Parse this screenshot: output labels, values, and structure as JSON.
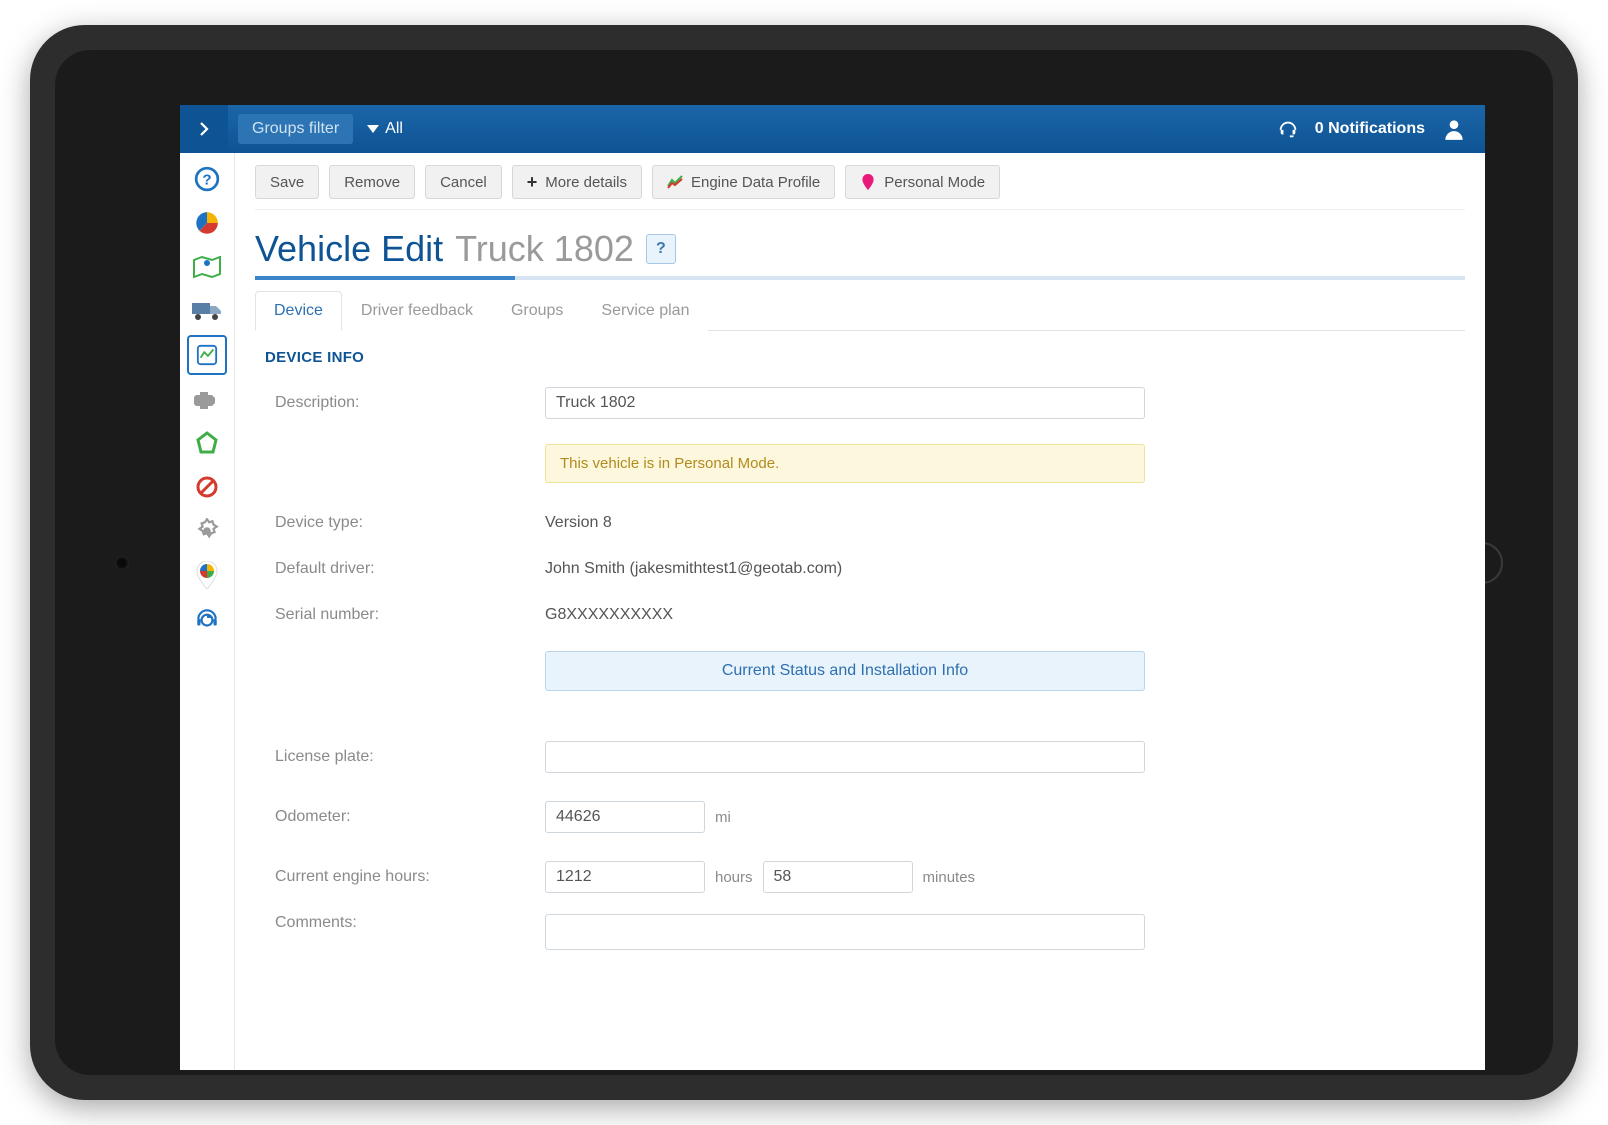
{
  "topbar": {
    "groups_filter": "Groups filter",
    "all_label": "All",
    "notifications": "0 Notifications"
  },
  "toolbar": {
    "save": "Save",
    "remove": "Remove",
    "cancel": "Cancel",
    "more_details": "More details",
    "engine_data": "Engine Data Profile",
    "personal_mode": "Personal Mode"
  },
  "title": {
    "main": "Vehicle Edit",
    "sub": "Truck 1802",
    "help": "?"
  },
  "tabs": {
    "device": "Device",
    "driver_feedback": "Driver feedback",
    "groups": "Groups",
    "service_plan": "Service plan"
  },
  "section": {
    "device_info": "DEVICE INFO"
  },
  "labels": {
    "description": "Description:",
    "device_type": "Device type:",
    "default_driver": "Default driver:",
    "serial_number": "Serial number:",
    "license_plate": "License plate:",
    "odometer": "Odometer:",
    "engine_hours": "Current engine hours:",
    "comments": "Comments:"
  },
  "values": {
    "description": "Truck 1802",
    "personal_mode_notice": "This vehicle is in Personal Mode.",
    "device_type": "Version 8",
    "default_driver": "John Smith (jakesmithtest1@geotab.com)",
    "serial_number": "G8XXXXXXXXXX",
    "status_button": "Current Status and Installation Info",
    "license_plate": "",
    "odometer": "44626",
    "odometer_unit": "mi",
    "engine_hours": "1212",
    "hours_unit": "hours",
    "engine_minutes": "58",
    "minutes_unit": "minutes",
    "comments": ""
  }
}
